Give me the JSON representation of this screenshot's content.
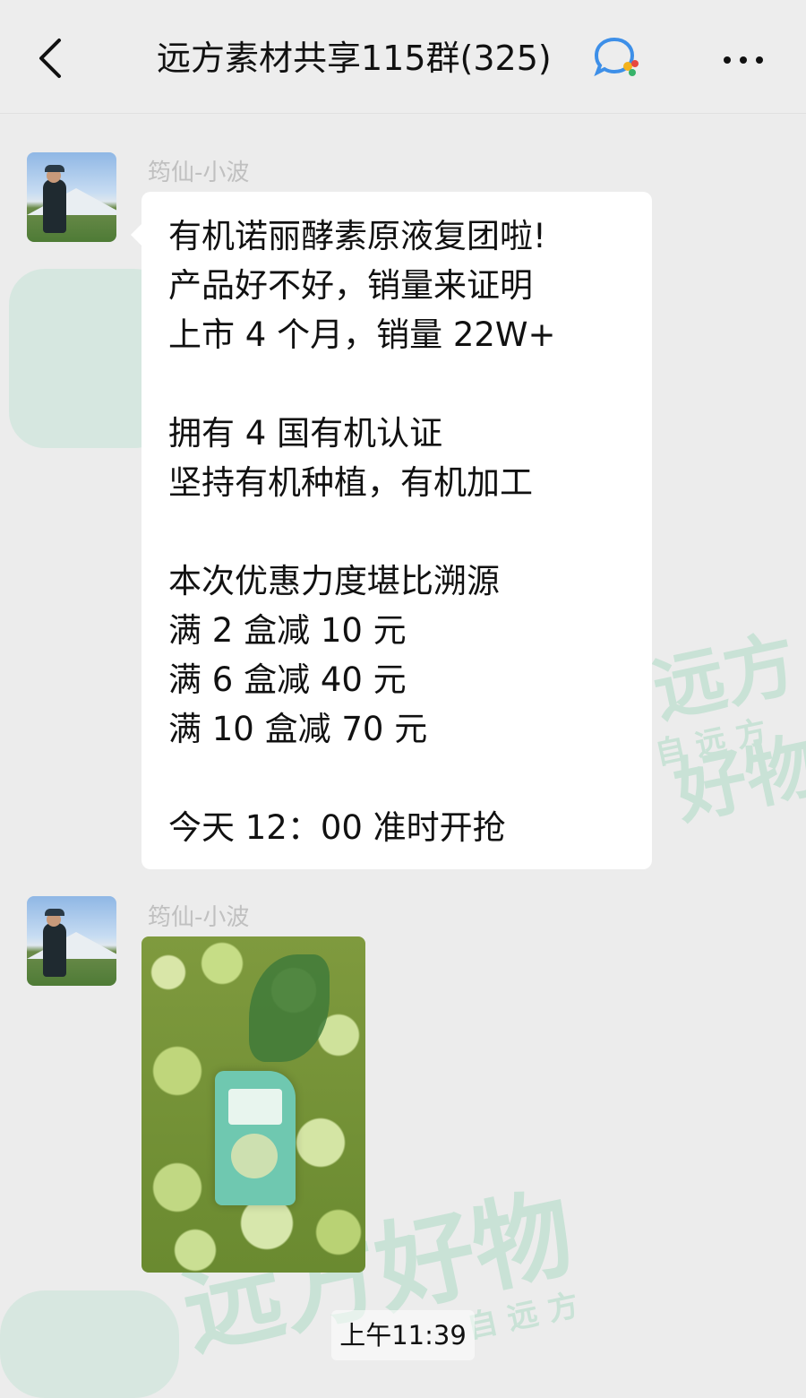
{
  "header": {
    "title": "远方素材共享115群(325)",
    "back_icon": "chevron-left-icon",
    "chat_icon": "group-chat-icon",
    "more_icon": "ellipsis-icon"
  },
  "messages": [
    {
      "sender": "筠仙-小波",
      "lines": [
        "有机诺丽酵素原液复团啦!",
        "产品好不好，销量来证明",
        "上市 4 个月，销量 22W+",
        "",
        "拥有 4 国有机认证",
        "坚持有机种植，有机加工",
        "",
        "本次优惠力度堪比溯源",
        "满 2 盒减 10 元",
        "满 6 盒减 40 元",
        "满 10 盒减 70 元",
        "",
        "今天 12：00 准时开抢"
      ]
    },
    {
      "sender": "筠仙-小波",
      "image": "noni-fruit-product-photo"
    }
  ],
  "timestamp": "上午11:39",
  "watermark": {
    "text": "远方好物",
    "subtext": "自远方"
  },
  "colors": {
    "background": "#ececec",
    "bubble": "#ffffff",
    "watermark": "#c9e2d6"
  }
}
